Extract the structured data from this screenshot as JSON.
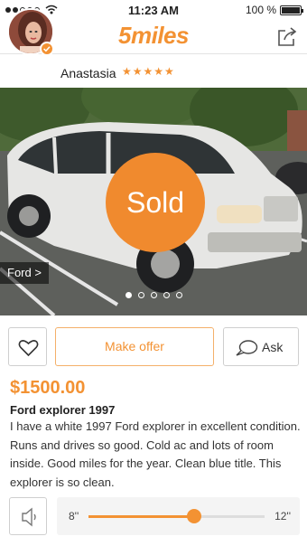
{
  "status_bar": {
    "time": "11:23 AM",
    "battery_text": "100 %",
    "battery_level": 1.0,
    "signal_icon": "signal-dots-icon",
    "wifi_icon": "wifi-icon"
  },
  "nav": {
    "logo": "5miles",
    "back_icon": "chevron-left-icon",
    "share_icon": "share-icon"
  },
  "seller": {
    "name": "Anastasia",
    "rating_stars": "★★★★★",
    "rating": 5,
    "verified_icon": "check-icon"
  },
  "listing": {
    "status": "Sold",
    "brand_tag": "Ford >",
    "photo_count": 5,
    "photo_index": 0,
    "price": "$1500.00",
    "title": "Ford explorer 1997",
    "description": "I have a white 1997 Ford explorer in excellent condition. Runs and drives so good. Cold ac and lots of room inside. Good miles for the year. Clean blue title. This explorer is so clean."
  },
  "actions": {
    "like_icon": "heart-icon",
    "make_offer_label": "Make offer",
    "ask_label": "Ask",
    "ask_icon": "chat-bubble-icon"
  },
  "audio": {
    "speaker_icon": "speaker-icon",
    "elapsed": "8''",
    "total": "12''",
    "progress": 0.6
  },
  "colors": {
    "accent": "#f39233",
    "sold_badge": "#f08a2e"
  }
}
